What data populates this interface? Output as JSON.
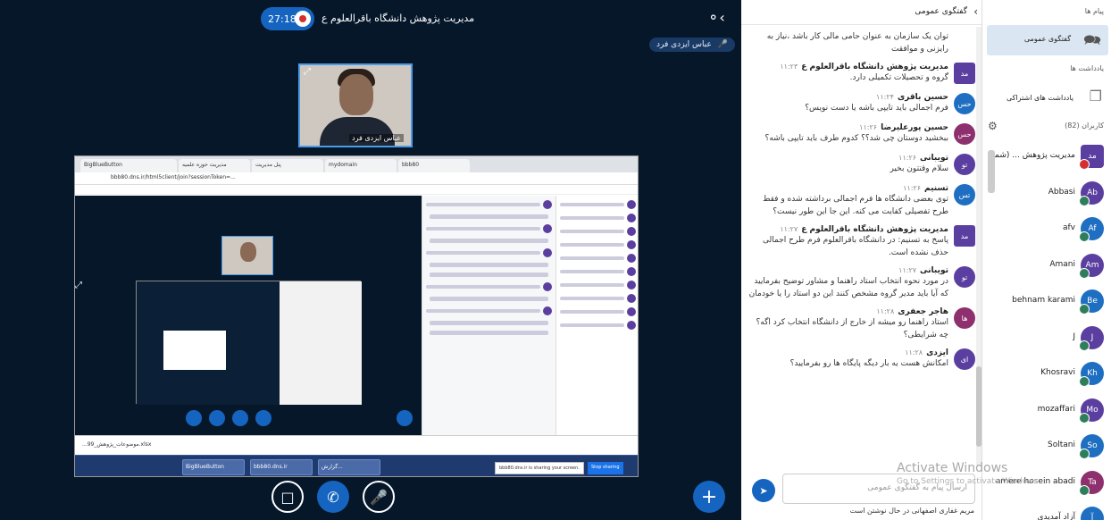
{
  "topbar": {
    "conference_title": "مدیریت پژوهش دانشگاه باقرالعلوم ع",
    "timer": "27:18",
    "talker": "عباس ایزدی فرد"
  },
  "webcam": {
    "name": "عباس ایزدی فرد"
  },
  "share": {
    "tabs": [
      "BigBlueButton",
      "مدیریت حوزه علمیه",
      "پنل مدیریت",
      "mydomain",
      "bbb80"
    ],
    "address": "bbb80.dns.ir/html5client/join?sessionToken=...",
    "downloads": "...موضوعات_پژوهش_99.xlsx",
    "share_note": "bbb80.dns.ir is sharing your screen.",
    "stop_label": "Stop sharing",
    "taskbar": [
      "BigBlueButton",
      "bbb80.dns.ir",
      "گزارش..."
    ]
  },
  "controls": {
    "cam": "camera-off",
    "phone": "phone",
    "mic": "mic-off",
    "plus": "+"
  },
  "chat": {
    "title": "گفتگوی عمومی",
    "messages": [
      {
        "initials": "",
        "name": "",
        "time": "",
        "text": "توان یک سازمان به عنوان حامی مالی کار باشد ،نیاز به رایزنی و موافقت",
        "color": "#5b3fa0",
        "square": false
      },
      {
        "initials": "مد",
        "name": "مدیریت پژوهش دانشگاه باقرالعلوم ع",
        "time": "۱۱:۲۳",
        "text": "گروه و تحصیلات تکمیلی دارد.",
        "color": "#5b3fa0",
        "square": true
      },
      {
        "initials": "حس",
        "name": "حسین باقری",
        "time": "۱۱:۲۴",
        "text": "فرم اجمالی باید تایپی باشه یا دست نویس؟",
        "color": "#1e6fc2",
        "square": false
      },
      {
        "initials": "حس",
        "name": "حسین پورعلیرضا",
        "time": "۱۱:۲۶",
        "text": "ببخشید دوستان چی شد؟؟ کدوم طرف باید تایپی باشه؟",
        "color": "#8e2f6e",
        "square": false
      },
      {
        "initials": "تو",
        "name": "تویبانی",
        "time": "۱۱:۲۶",
        "text": "سلام وقتتون بخیر",
        "color": "#5b3fa0",
        "square": false
      },
      {
        "initials": "تس",
        "name": "تسنیم",
        "time": "۱۱:۲۶",
        "text": "توی بعضی دانشگاه ها فرم اجمالی برداشته شده و فقط طرح تفصیلی کفایت می کنه. این جا این طور نیست؟",
        "color": "#1e6fc2",
        "square": false
      },
      {
        "initials": "مد",
        "name": "مدیریت پژوهش دانشگاه باقرالعلوم ع",
        "time": "۱۱:۲۷",
        "text": "پاسخ به تسنیم: در دانشگاه باقرالعلوم فرم طرح اجمالی حذف نشده است.",
        "color": "#5b3fa0",
        "square": true
      },
      {
        "initials": "تو",
        "name": "تویبانی",
        "time": "۱۱:۲۷",
        "text": "در مورد نحوه انتخاب استاد راهنما و مشاور توضیح بفرمایید که آیا باید مدیر گروه مشخص کنند این دو استاد را یا خودمان",
        "color": "#5b3fa0",
        "square": false
      },
      {
        "initials": "ها",
        "name": "هاجر جعفری",
        "time": "۱۱:۲۸",
        "text": "استاد راهنما رو میشه از خارج از دانشگاه انتخاب کرد اگه؟ چه شرایطی؟",
        "color": "#8e2f6e",
        "square": false
      },
      {
        "initials": "ای",
        "name": "ایزدی",
        "time": "۱۱:۲۸",
        "text": "امکانش هست یه بار دیگه پایگاه ها رو بفرمایید؟",
        "color": "#5b3fa0",
        "square": false
      }
    ],
    "input_placeholder": "ارسال پیام به گفتگوی عمومی",
    "typing": "مریم غفاری اصفهانی در حال نوشتن است"
  },
  "watermark": {
    "line1": "Activate Windows",
    "line2": "Go to Settings to activate Windows."
  },
  "users": {
    "messages_label": "پیام ها",
    "public_chat_label": "گفتگوی عمومی",
    "notes_section": "یادداشت ها",
    "shared_notes_label": "یادداشت های اشتراکی",
    "users_count_label": "کاربران (82)",
    "list": [
      {
        "name": "مدیریت پژوهش ... (شما)",
        "initials": "مد",
        "color": "#5b3fa0",
        "square": true,
        "red": true
      },
      {
        "name": "Abbasi",
        "initials": "Ab",
        "color": "#5b3fa0",
        "square": false,
        "red": false
      },
      {
        "name": "afv",
        "initials": "Af",
        "color": "#1e6fc2",
        "square": false,
        "red": false
      },
      {
        "name": "Amani",
        "initials": "Am",
        "color": "#5b3fa0",
        "square": false,
        "red": false
      },
      {
        "name": "behnam karami",
        "initials": "Be",
        "color": "#1e6fc2",
        "square": false,
        "red": false
      },
      {
        "name": "J",
        "initials": "J",
        "color": "#5b3fa0",
        "square": false,
        "red": false
      },
      {
        "name": "Khosravi",
        "initials": "Kh",
        "color": "#1e6fc2",
        "square": false,
        "red": false
      },
      {
        "name": "mozaffari",
        "initials": "Mo",
        "color": "#5b3fa0",
        "square": false,
        "red": false
      },
      {
        "name": "Soltani",
        "initials": "So",
        "color": "#1e6fc2",
        "square": false,
        "red": false
      },
      {
        "name": "amere hosein abadi",
        "initials": "Ta",
        "color": "#8e2f6e",
        "square": false,
        "red": false
      },
      {
        "name": "آزاد آمدیدی",
        "initials": "آ",
        "color": "#1e6fc2",
        "square": false,
        "red": false
      }
    ]
  }
}
